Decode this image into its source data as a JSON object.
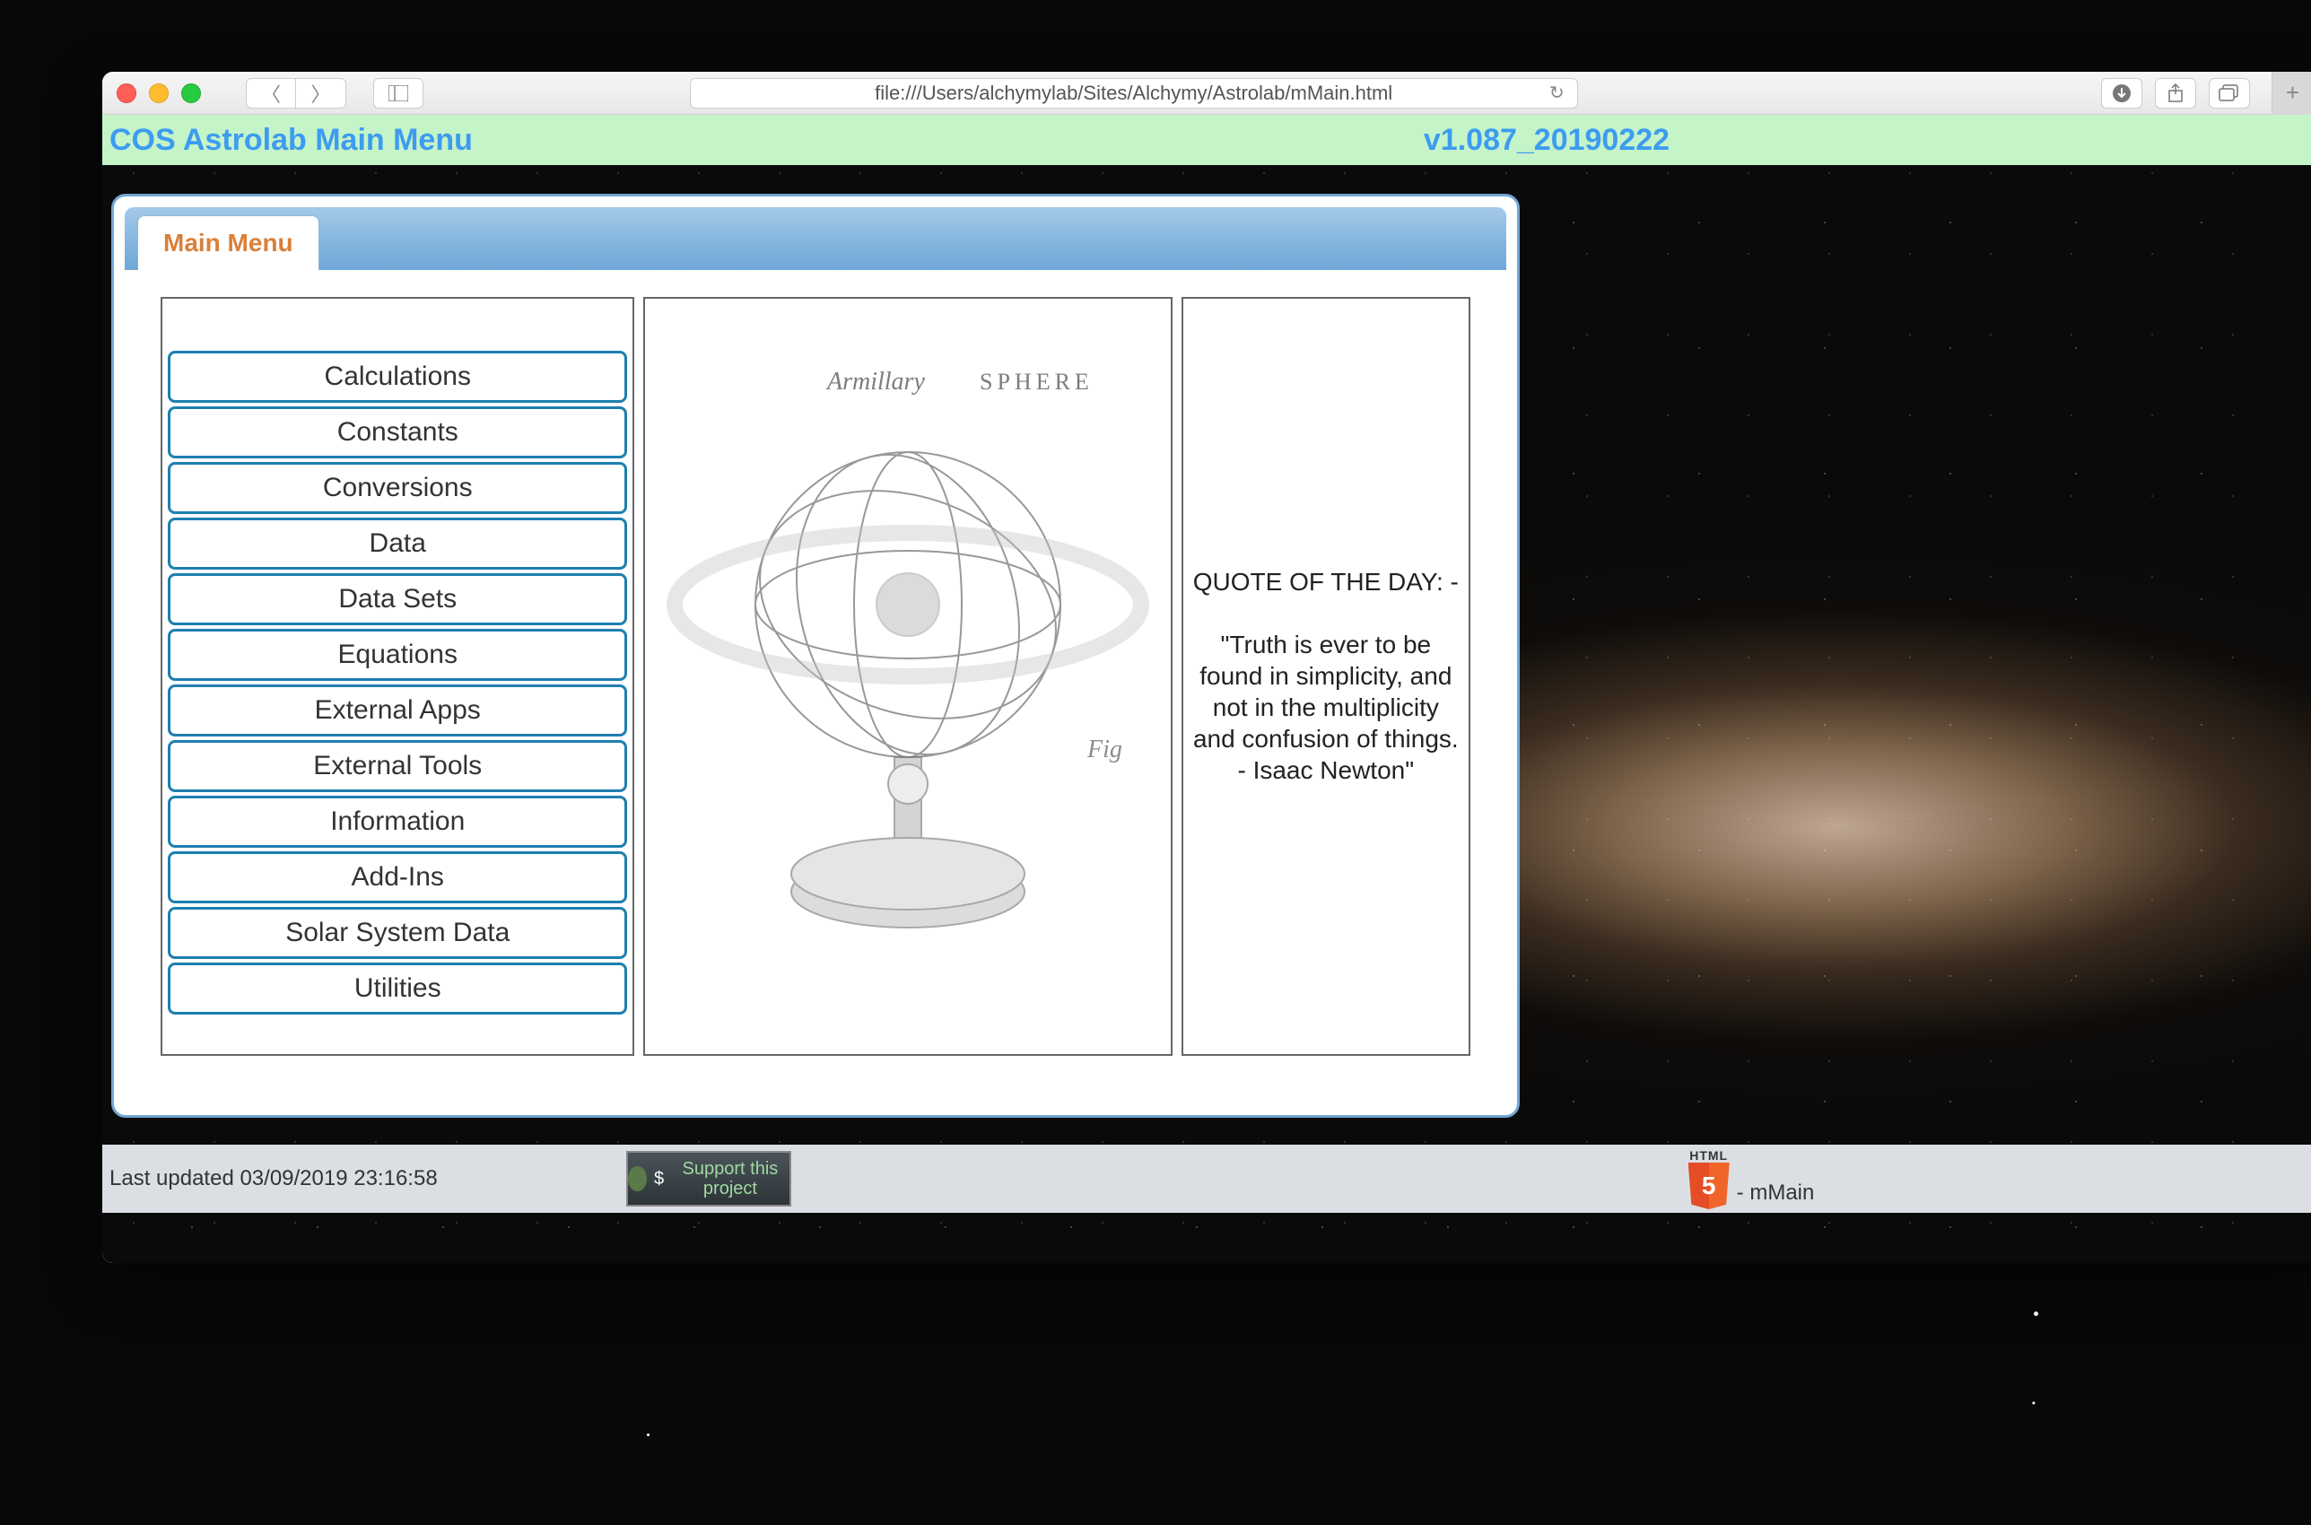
{
  "browser": {
    "url": "file:///Users/alchymylab/Sites/Alchymy/Astrolab/mMain.html"
  },
  "header": {
    "title": "COS Astrolab Main Menu",
    "version": "v1.087_20190222"
  },
  "tab": {
    "label": "Main Menu"
  },
  "menu": {
    "items": [
      "Calculations",
      "Constants",
      "Conversions",
      "Data",
      "Data Sets",
      "Equations",
      "External Apps",
      "External Tools",
      "Information",
      "Add-Ins",
      "Solar System Data",
      "Utilities"
    ]
  },
  "centerImage": {
    "label_italic": "Armillary",
    "label_caps": "SPHERE"
  },
  "quote": {
    "heading": "QUOTE OF THE DAY: -",
    "text": "\"Truth is ever to be found in simplicity, and not in the multiplicity and confusion of things. - Isaac Newton\""
  },
  "footer": {
    "updated": "Last updated 03/09/2019 23:16:58",
    "support": "Support this project",
    "html5_label": "HTML",
    "page_id": "- mMain"
  }
}
